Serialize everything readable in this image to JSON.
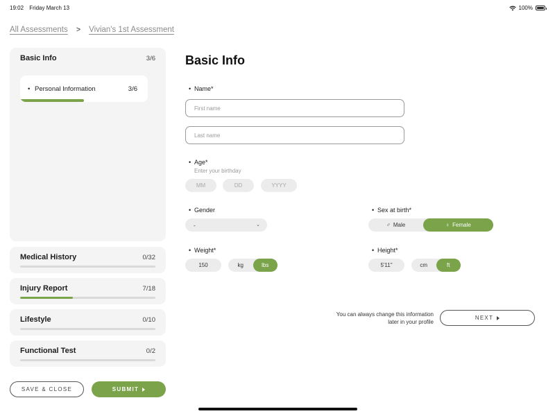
{
  "status_bar": {
    "time": "19:02",
    "date": "Friday March 13",
    "battery": "100%"
  },
  "breadcrumb": {
    "root": "All Assessments",
    "separator": ">",
    "current": "Vivian's 1st Assessment"
  },
  "sidebar": {
    "sections": [
      {
        "title": "Basic Info",
        "count": "3/6",
        "progress": 0.5,
        "subsections": [
          {
            "label": "Personal Information",
            "count": "3/6",
            "progress": 0.5
          }
        ]
      },
      {
        "title": "Medical History",
        "count": "0/32",
        "progress": 0.0
      },
      {
        "title": "Injury Report",
        "count": "7/18",
        "progress": 0.39
      },
      {
        "title": "Lifestyle",
        "count": "0/10",
        "progress": 0.0
      },
      {
        "title": "Functional Test",
        "count": "0/2",
        "progress": 0.0
      }
    ],
    "save_label": "SAVE & CLOSE",
    "submit_label": "SUBMIT"
  },
  "form": {
    "title": "Basic Info",
    "name": {
      "label": "Name*",
      "first_placeholder": "First name",
      "last_placeholder": "Last name"
    },
    "age": {
      "label": "Age*",
      "hint": "Enter your birthday",
      "month": "MM",
      "day": "DD",
      "year": "YYYY"
    },
    "gender": {
      "label": "Gender",
      "value": "-"
    },
    "sex_at_birth": {
      "label": "Sex at birth*",
      "options": [
        "Male",
        "Female"
      ],
      "selected": "Female"
    },
    "weight": {
      "label": "Weight*",
      "value": "150",
      "units": [
        "kg",
        "lbs"
      ],
      "selected_unit": "lbs"
    },
    "height": {
      "label": "Height*",
      "value": "5'11\"",
      "units": [
        "cm",
        "ft"
      ],
      "selected_unit": "ft"
    },
    "note": "You can always change this information later in your profile",
    "next_label": "NEXT"
  },
  "colors": {
    "accent": "#7aa34a",
    "card_bg": "#f4f4f4",
    "pill_bg": "#ececec"
  }
}
